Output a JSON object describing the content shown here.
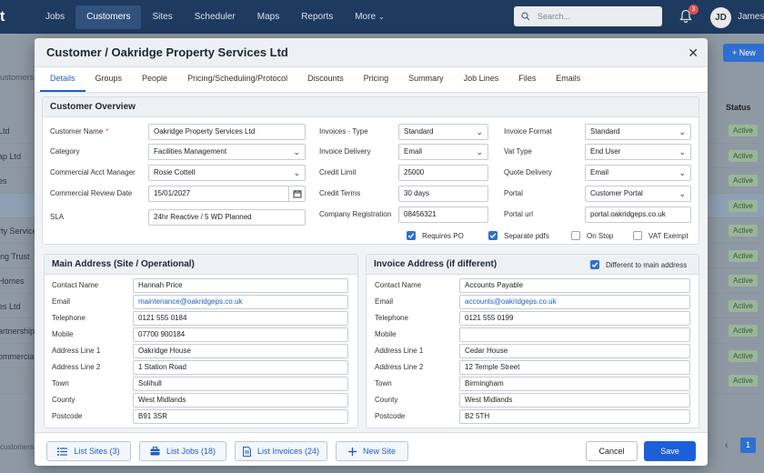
{
  "nav": {
    "brand": "t",
    "items": [
      {
        "label": "Jobs",
        "active": false
      },
      {
        "label": "Customers",
        "active": true
      },
      {
        "label": "Sites",
        "active": false
      },
      {
        "label": "Scheduler",
        "active": false
      },
      {
        "label": "Maps",
        "active": false
      },
      {
        "label": "Reports",
        "active": false
      },
      {
        "label": "More",
        "active": false
      }
    ],
    "search_placeholder": "Search...",
    "notification_count": "3",
    "user_initials": "JD",
    "user_name": "James"
  },
  "background": {
    "search_text": "ustomers...",
    "new_button": "+ New",
    "status_header": "Status",
    "rows": [
      {
        "name": "Ltd",
        "status": "Active"
      },
      {
        "name": "ap Ltd",
        "status": "Active"
      },
      {
        "name": "es",
        "status": "Active"
      },
      {
        "name": "",
        "status": "Active"
      },
      {
        "name": "rty Service",
        "status": "Active"
      },
      {
        "name": "ing Trust",
        "status": "Active"
      },
      {
        "name": "Homes",
        "status": "Active"
      },
      {
        "name": "es Ltd",
        "status": "Active"
      },
      {
        "name": "artnership",
        "status": "Active"
      },
      {
        "name": "ommercial",
        "status": "Active"
      },
      {
        "name": "",
        "status": "Active"
      }
    ],
    "footer_text": "customers",
    "page_number": "1"
  },
  "modal": {
    "title": "Customer  /  Oakridge Property Services Ltd",
    "tabs": [
      "Details",
      "Groups",
      "People",
      "Pricing/Scheduling/Protocol",
      "Discounts",
      "Pricing",
      "Summary",
      "Job Lines",
      "Files",
      "Emails"
    ],
    "active_tab": "Details",
    "overview": {
      "title": "Customer Overview",
      "customer_name_label": "Customer Name",
      "customer_name": "Oakridge Property Services Ltd",
      "category_label": "Category",
      "category": "Facilities Management",
      "account_manager_label": "Commercial Acct Manager",
      "account_manager": "Rosie Cottell",
      "review_date_label": "Commercial Review Date",
      "review_date": "15/01/2027",
      "sla_label": "SLA",
      "sla": "24hr Reactive / 5 WD Planned",
      "invoices_type_label": "Invoices - Type",
      "invoices_type": "Standard",
      "invoice_delivery_label": "Invoice Delivery",
      "invoice_delivery": "Email",
      "credit_limit_label": "Credit Limit",
      "credit_limit": "25000",
      "credit_terms_label": "Credit Terms",
      "credit_terms": "30 days",
      "company_reg_label": "Company Registration",
      "company_reg": "08456321",
      "invoice_format_label": "Invoice Format",
      "invoice_format": "Standard",
      "vat_type_label": "Vat Type",
      "vat_type": "End User",
      "quote_delivery_label": "Quote Delivery",
      "quote_delivery": "Email",
      "portal_label": "Portal",
      "portal": "Customer Portal",
      "portal_url_label": "Portal url",
      "portal_url": "portal.oakridgeps.co.uk",
      "requires_po_label": "Requires PO",
      "requires_po": true,
      "separate_pdfs_label": "Separate pdfs",
      "separate_pdfs": true,
      "on_stop_label": "On Stop",
      "on_stop": false,
      "vat_exempt_label": "VAT Exempt",
      "vat_exempt": false
    },
    "main_address": {
      "title": "Main Address (Site / Operational)",
      "labels": [
        "Contact Name",
        "Email",
        "Telephone",
        "Mobile",
        "Address Line 1",
        "Address Line 2",
        "Town",
        "County",
        "Postcode"
      ],
      "values": [
        "Hannah Price",
        "maintenance@oakridgeps.co.uk",
        "0121 555 0184",
        "07700 900184",
        "Oakridge House",
        "1 Station Road",
        "Solihull",
        "West Midlands",
        "B91 3SR"
      ]
    },
    "invoice_address": {
      "title": "Invoice Address (if different)",
      "different_label": "Different to main address",
      "different": true,
      "labels": [
        "Contact Name",
        "Email",
        "Telephone",
        "Mobile",
        "Address Line 1",
        "Address Line 2",
        "Town",
        "County",
        "Postcode"
      ],
      "values": [
        "Accounts Payable",
        "accounts@oakridgeps.co.uk",
        "0121 555 0199",
        "",
        "Cedar House",
        "12 Temple Street",
        "Birmingham",
        "West Midlands",
        "B2 5TH"
      ]
    },
    "footer": {
      "list_sites": "List Sites (3)",
      "list_jobs": "List Jobs (18)",
      "list_invoices": "List Invoices (24)",
      "new_site": "New Site",
      "cancel": "Cancel",
      "save": "Save"
    }
  },
  "colors": {
    "nav_bg": "#1f3a5f",
    "accent": "#1d5fc4",
    "save_button": "#1d5fd8",
    "status_active": "#9bb59b"
  }
}
